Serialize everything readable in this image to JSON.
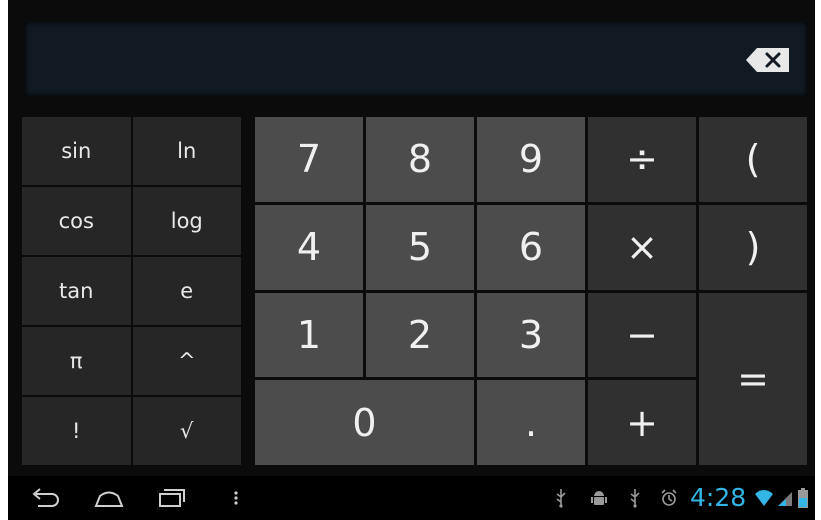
{
  "display": {
    "expression": "",
    "backspace_icon": "backspace-icon"
  },
  "scientific_keys": [
    "sin",
    "ln",
    "cos",
    "log",
    "tan",
    "e",
    "π",
    "^",
    "!",
    "√"
  ],
  "keypad": {
    "seven": "7",
    "eight": "8",
    "nine": "9",
    "divide": "÷",
    "open_paren": "(",
    "four": "4",
    "five": "5",
    "six": "6",
    "multiply": "×",
    "close_paren": ")",
    "one": "1",
    "two": "2",
    "three": "3",
    "minus": "−",
    "equals": "=",
    "zero": "0",
    "dot": ".",
    "plus": "+"
  },
  "statusbar": {
    "time": "4:28",
    "icons": [
      "usb-icon",
      "android-debug-icon",
      "usb-icon",
      "alarm-icon",
      "wifi-icon",
      "signal-icon",
      "battery-icon"
    ]
  },
  "navbar": {
    "buttons": [
      "back-icon",
      "home-icon",
      "recent-apps-icon",
      "menu-icon"
    ]
  },
  "colors": {
    "accent": "#33b5e5",
    "display_bg": "#111a22",
    "digit_key": "#4c4c4c",
    "operator_key": "#303030",
    "function_key": "#262626"
  }
}
